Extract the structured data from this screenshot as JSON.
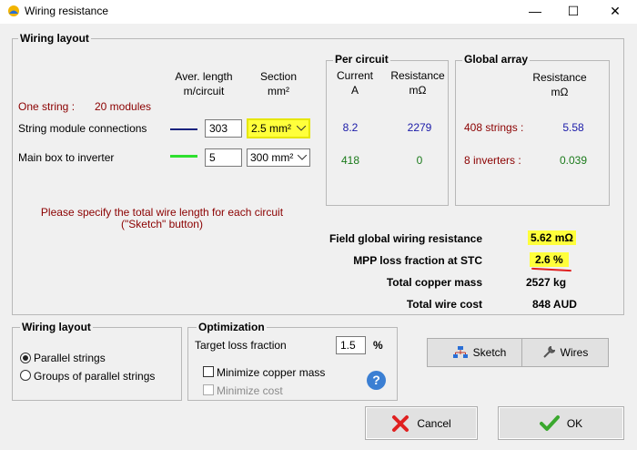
{
  "window": {
    "title": "Wiring resistance"
  },
  "wiring_layout": {
    "title": "Wiring layout",
    "col_length": [
      "Aver. length",
      "m/circuit"
    ],
    "col_section": [
      "Section",
      "mm²"
    ],
    "one_string_label": "One string :",
    "modules_label": "20 modules",
    "rows": [
      {
        "label": "String module connections",
        "length": "303",
        "section": "2.5 mm²",
        "line_color": "#1a237e"
      },
      {
        "label": "Main box to inverter",
        "length": "5",
        "section": "300 mm²",
        "line_color": "#2ee02e"
      }
    ],
    "note": [
      "Please specify the total wire length for each circuit",
      "(\"Sketch\" button)"
    ]
  },
  "per_circuit": {
    "title": "Per circuit",
    "col_current": [
      "Current",
      "A"
    ],
    "col_resistance": [
      "Resistance",
      "mΩ"
    ],
    "rows": [
      {
        "current": "8.2",
        "resistance": "2279"
      },
      {
        "current": "418",
        "resistance": "0"
      }
    ]
  },
  "global_array": {
    "title": "Global array",
    "col_resistance": [
      "Resistance",
      "mΩ"
    ],
    "rows": [
      {
        "label": "408 strings :",
        "resistance": "5.58"
      },
      {
        "label": "8 inverters :",
        "resistance": "0.039"
      }
    ]
  },
  "summary": [
    {
      "label": "Field global wiring resistance",
      "value": "5.62 mΩ"
    },
    {
      "label": "MPP loss fraction at STC",
      "value": "2.6 %"
    },
    {
      "label": "Total copper mass",
      "value": "2527 kg"
    },
    {
      "label": "Total wire cost",
      "value": "848 AUD"
    }
  ],
  "layout_options": {
    "title": "Wiring layout",
    "options": [
      "Parallel strings",
      "Groups of parallel strings"
    ],
    "selected": "Parallel strings"
  },
  "optimization": {
    "title": "Optimization",
    "target_label": "Target loss fraction",
    "target_value": "1.5",
    "target_unit": "%",
    "minimize_copper": "Minimize copper mass",
    "minimize_cost": "Minimize cost"
  },
  "buttons": {
    "sketch": "Sketch",
    "wires": "Wires",
    "cancel": "Cancel",
    "ok": "OK"
  },
  "colors": {
    "highlight": "#ffff3b",
    "accent_red": "#8b0000",
    "value_blue": "#1a1aa8",
    "value_green": "#1b7a1b"
  }
}
